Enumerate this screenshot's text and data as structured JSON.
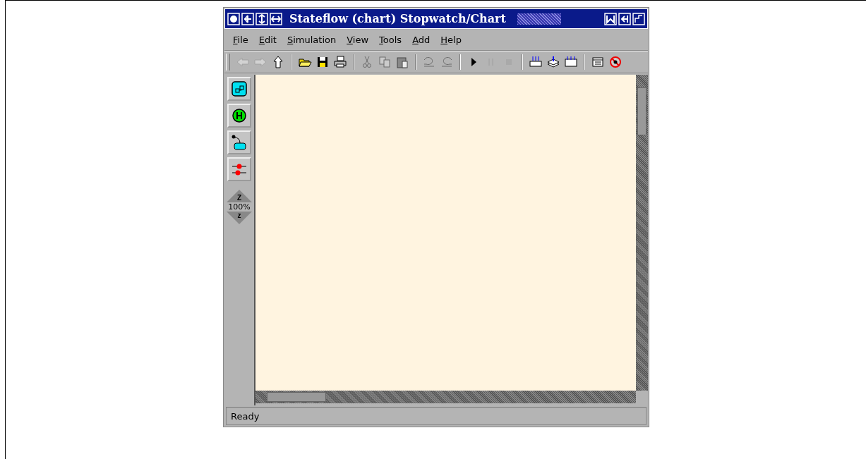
{
  "window": {
    "title": "Stateflow (chart) Stopwatch/Chart"
  },
  "menu": [
    {
      "label": "File"
    },
    {
      "label": "Edit"
    },
    {
      "label": "Simulation"
    },
    {
      "label": "View"
    },
    {
      "label": "Tools"
    },
    {
      "label": "Add"
    },
    {
      "label": "Help"
    }
  ],
  "toolbar": [
    [
      {
        "kind": "back",
        "disabled": true
      },
      {
        "kind": "forward",
        "disabled": true
      },
      {
        "kind": "up",
        "disabled": false
      }
    ],
    [
      {
        "kind": "open",
        "disabled": false
      },
      {
        "kind": "save",
        "disabled": false
      },
      {
        "kind": "print",
        "disabled": false
      }
    ],
    [
      {
        "kind": "cut",
        "disabled": true
      },
      {
        "kind": "copy",
        "disabled": true
      },
      {
        "kind": "paste",
        "disabled": false
      }
    ],
    [
      {
        "kind": "undo",
        "disabled": true
      },
      {
        "kind": "redo",
        "disabled": true
      }
    ],
    [
      {
        "kind": "play",
        "disabled": false
      },
      {
        "kind": "pause",
        "disabled": true
      },
      {
        "kind": "stop",
        "disabled": true
      }
    ],
    [
      {
        "kind": "build",
        "disabled": false
      },
      {
        "kind": "layers",
        "disabled": false
      },
      {
        "kind": "rebuild",
        "disabled": false
      }
    ],
    [
      {
        "kind": "explorer",
        "disabled": false
      },
      {
        "kind": "debug",
        "disabled": false
      }
    ]
  ],
  "palette": [
    {
      "kind": "state"
    },
    {
      "kind": "history"
    },
    {
      "kind": "default-transition"
    },
    {
      "kind": "connective"
    }
  ],
  "zoom": {
    "in": "Z",
    "level": "100%",
    "out": "z"
  },
  "status_bar": "Ready"
}
